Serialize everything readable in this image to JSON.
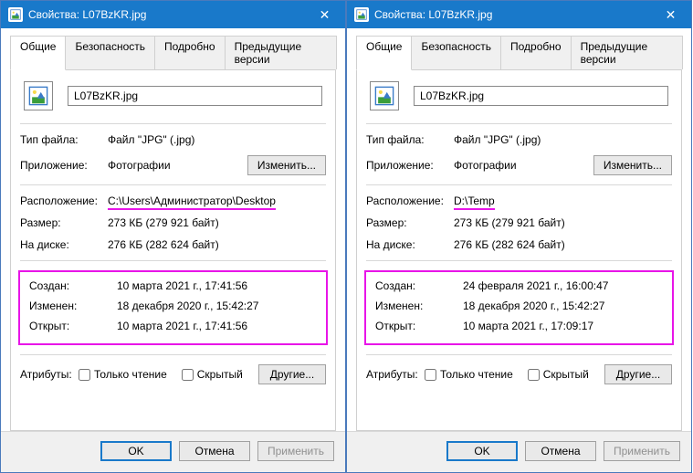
{
  "windows": [
    {
      "title": "Свойства: L07BzKR.jpg",
      "tabs": [
        "Общие",
        "Безопасность",
        "Подробно",
        "Предыдущие версии"
      ],
      "activeTab": 0,
      "filename": "L07BzKR.jpg",
      "fields": {
        "type_label": "Тип файла:",
        "type_value": "Файл \"JPG\" (.jpg)",
        "app_label": "Приложение:",
        "app_value": "Фотографии",
        "change_btn": "Изменить...",
        "loc_label": "Расположение:",
        "loc_value": "C:\\Users\\Администратор\\Desktop",
        "size_label": "Размер:",
        "size_value": "273 КБ (279 921 байт)",
        "disk_label": "На диске:",
        "disk_value": "276 КБ (282 624 байт)",
        "created_label": "Создан:",
        "created_value": "10 марта 2021 г., 17:41:56",
        "modified_label": "Изменен:",
        "modified_value": "18 декабря 2020 г., 15:42:27",
        "accessed_label": "Открыт:",
        "accessed_value": "10 марта 2021 г., 17:41:56",
        "attr_label": "Атрибуты:",
        "readonly_label": "Только чтение",
        "hidden_label": "Скрытый",
        "other_btn": "Другие..."
      },
      "footer": {
        "ok": "OK",
        "cancel": "Отмена",
        "apply": "Применить"
      }
    },
    {
      "title": "Свойства: L07BzKR.jpg",
      "tabs": [
        "Общие",
        "Безопасность",
        "Подробно",
        "Предыдущие версии"
      ],
      "activeTab": 0,
      "filename": "L07BzKR.jpg",
      "fields": {
        "type_label": "Тип файла:",
        "type_value": "Файл \"JPG\" (.jpg)",
        "app_label": "Приложение:",
        "app_value": "Фотографии",
        "change_btn": "Изменить...",
        "loc_label": "Расположение:",
        "loc_value": "D:\\Temp",
        "size_label": "Размер:",
        "size_value": "273 КБ (279 921 байт)",
        "disk_label": "На диске:",
        "disk_value": "276 КБ (282 624 байт)",
        "created_label": "Создан:",
        "created_value": "24 февраля 2021 г., 16:00:47",
        "modified_label": "Изменен:",
        "modified_value": "18 декабря 2020 г., 15:42:27",
        "accessed_label": "Открыт:",
        "accessed_value": "10 марта 2021 г., 17:09:17",
        "attr_label": "Атрибуты:",
        "readonly_label": "Только чтение",
        "hidden_label": "Скрытый",
        "other_btn": "Другие..."
      },
      "footer": {
        "ok": "OK",
        "cancel": "Отмена",
        "apply": "Применить"
      }
    }
  ]
}
